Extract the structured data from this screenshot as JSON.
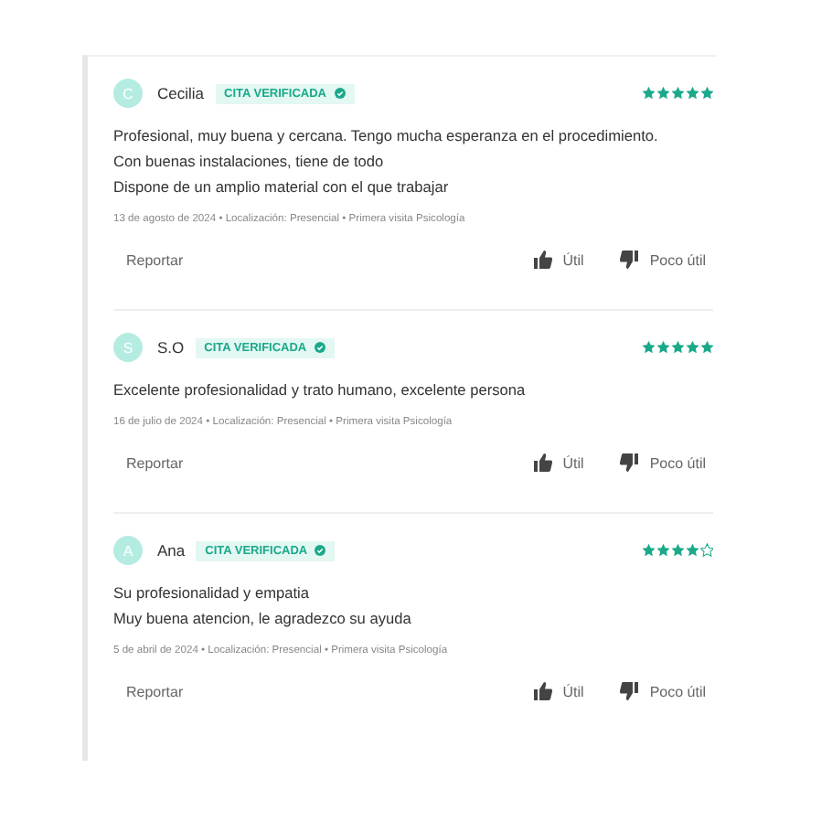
{
  "reviews": [
    {
      "initial": "C",
      "name": "Cecilia",
      "badge": "CITA VERIFICADA",
      "stars": 5,
      "lines": [
        "Profesional, muy buena y cercana. Tengo mucha esperanza en el procedimiento.",
        "Con buenas instalaciones, tiene de todo",
        "Dispone de un amplio material con el que trabajar"
      ],
      "meta": "13 de agosto de 2024 • Localización: Presencial • Primera visita Psicología",
      "report": "Reportar",
      "useful": "Útil",
      "not_useful": "Poco útil"
    },
    {
      "initial": "S",
      "name": "S.O",
      "badge": "CITA VERIFICADA",
      "stars": 5,
      "lines": [
        "Excelente profesionalidad y trato humano, excelente persona"
      ],
      "meta": "16 de julio de 2024 • Localización: Presencial • Primera visita Psicología",
      "report": "Reportar",
      "useful": "Útil",
      "not_useful": "Poco útil"
    },
    {
      "initial": "A",
      "name": "Ana",
      "badge": "CITA VERIFICADA",
      "stars": 4,
      "lines": [
        "Su profesionalidad y empatia",
        "Muy buena atencion, le agradezco su ayuda"
      ],
      "meta": "5 de abril de 2024 • Localización: Presencial • Primera visita Psicología",
      "report": "Reportar",
      "useful": "Útil",
      "not_useful": "Poco útil"
    }
  ]
}
